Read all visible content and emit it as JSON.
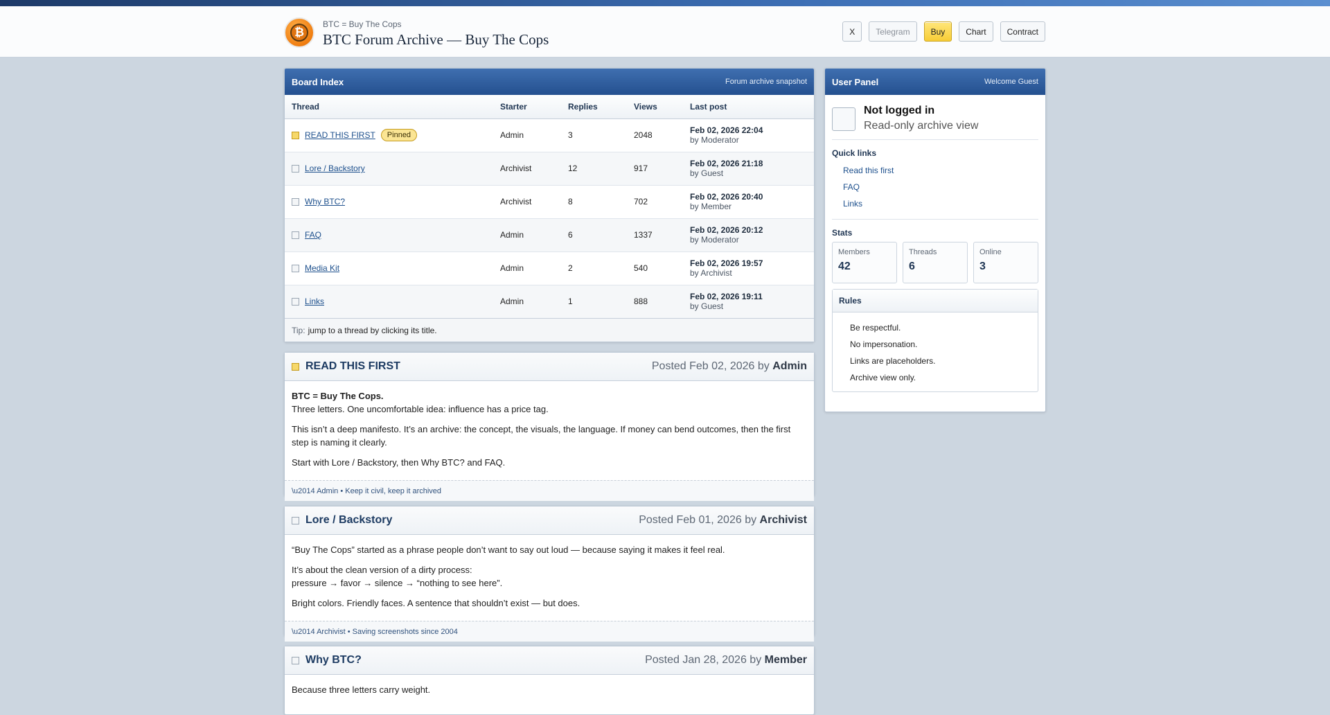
{
  "header": {
    "subtitle": "BTC = Buy The Cops",
    "title": "BTC Forum Archive — Buy The Cops",
    "nav": [
      "X",
      "Telegram",
      "Buy",
      "Chart",
      "Contract"
    ]
  },
  "board": {
    "title": "Board Index",
    "note": "Forum archive snapshot",
    "columns": [
      "Thread",
      "Starter",
      "Replies",
      "Views",
      "Last post"
    ],
    "rows": [
      {
        "title": "READ THIS FIRST",
        "badge": "Pinned",
        "starter": "Admin",
        "replies": "3",
        "views": "2048",
        "date": "Feb 02, 2026 22:04",
        "by": "by Moderator"
      },
      {
        "title": "Lore / Backstory",
        "starter": "Archivist",
        "replies": "12",
        "views": "917",
        "date": "Feb 02, 2026 21:18",
        "by": "by Guest"
      },
      {
        "title": "Why BTC?",
        "starter": "Archivist",
        "replies": "8",
        "views": "702",
        "date": "Feb 02, 2026 20:40",
        "by": "by Member"
      },
      {
        "title": "FAQ",
        "starter": "Admin",
        "replies": "6",
        "views": "1337",
        "date": "Feb 02, 2026 20:12",
        "by": "by Moderator"
      },
      {
        "title": "Media Kit",
        "starter": "Admin",
        "replies": "2",
        "views": "540",
        "date": "Feb 02, 2026 19:57",
        "by": "by Archivist"
      },
      {
        "title": "Links",
        "starter": "Admin",
        "replies": "1",
        "views": "888",
        "date": "Feb 02, 2026 19:11",
        "by": "by Guest"
      }
    ],
    "tip_label": "Tip:",
    "tip_text": "jump to a thread by clicking its title."
  },
  "posts": [
    {
      "title": "READ THIS FIRST",
      "posted": "Posted Feb 02, 2026 by ",
      "author": "Admin",
      "bold_line": "BTC = Buy The Cops.",
      "line1": "Three letters. One uncomfortable idea: influence has a price tag.",
      "para2": "This isn’t a deep manifesto. It’s an archive: the concept, the visuals, the language. If money can bend outcomes, then the first step is naming it clearly.",
      "para3": "Start with Lore / Backstory, then Why BTC? and FAQ.",
      "footer": "\\u2014 Admin • Keep it civil, keep it archived"
    },
    {
      "title": "Lore / Backstory",
      "posted": "Posted Feb 01, 2026 by ",
      "author": "Archivist",
      "para1": "“Buy The Cops” started as a phrase people don’t want to say out loud — because saying it makes it feel real.",
      "para2a": "It’s about the clean version of a dirty process:",
      "para2b": "pressure → favor → silence → “nothing to see here”.",
      "para3": "Bright colors. Friendly faces. A sentence that shouldn’t exist — but does.",
      "footer": "\\u2014 Archivist • Saving screenshots since 2004"
    },
    {
      "title": "Why BTC?",
      "posted": "Posted Jan 28, 2026 by ",
      "author": "Member",
      "para1": "Because three letters carry weight."
    }
  ],
  "user_panel": {
    "title": "User Panel",
    "welcome": "Welcome Guest",
    "status": "Not logged in",
    "mode": "Read-only archive view",
    "quick_links_title": "Quick links",
    "quick_links": [
      "Read this first",
      "FAQ",
      "Links"
    ],
    "stats_title": "Stats",
    "stats": [
      {
        "label": "Members",
        "value": "42"
      },
      {
        "label": "Threads",
        "value": "6"
      },
      {
        "label": "Online",
        "value": "3"
      }
    ],
    "rules_title": "Rules",
    "rules": [
      "Be respectful.",
      "No impersonation.",
      "Links are placeholders.",
      "Archive view only."
    ]
  }
}
